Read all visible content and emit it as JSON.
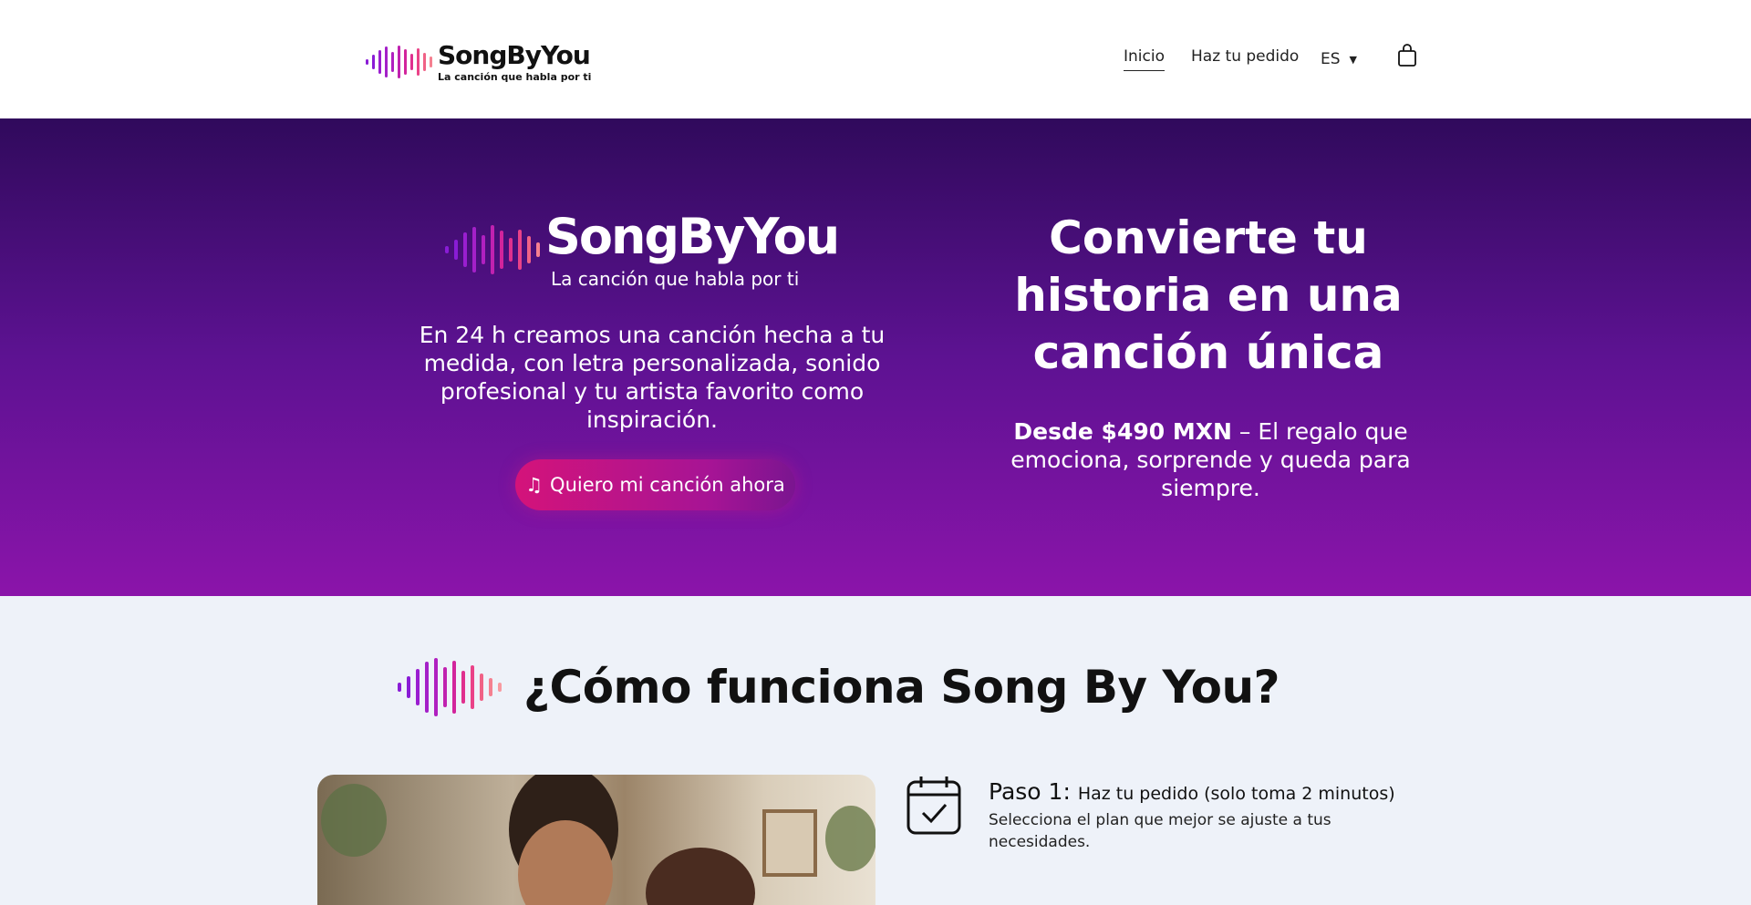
{
  "brand": {
    "name": "SongByYou",
    "tagline": "La canción que habla por ti"
  },
  "nav": {
    "inicio": "Inicio",
    "pedido": "Haz tu pedido",
    "lang": "ES",
    "caret": "▼",
    "cart_icon": "shopping-bag-icon"
  },
  "hero": {
    "description": "En 24 h creamos una canción hecha a tu medida, con letra personalizada, sonido profesional y tu artista favorito como inspiración.",
    "cta_icon": "♫",
    "cta_label": "Quiero mi canción ahora",
    "title": "Convierte tu historia en una canción única",
    "price_bold": "Desde $490 MXN",
    "price_rest": " – El regalo que emociona, sorprende y queda para siempre."
  },
  "how": {
    "title": "¿Cómo funciona Song By You?",
    "step1_label": "Paso 1:",
    "step1_title": "Haz tu pedido (solo toma 2 minutos)",
    "step1_desc": "Selecciona el plan que mejor se ajuste a tus necesidades."
  },
  "colors": {
    "hero_top": "#300a5c",
    "hero_bottom": "#8b14aa",
    "cta": "#d4137a",
    "section_bg": "#eef2f9"
  }
}
